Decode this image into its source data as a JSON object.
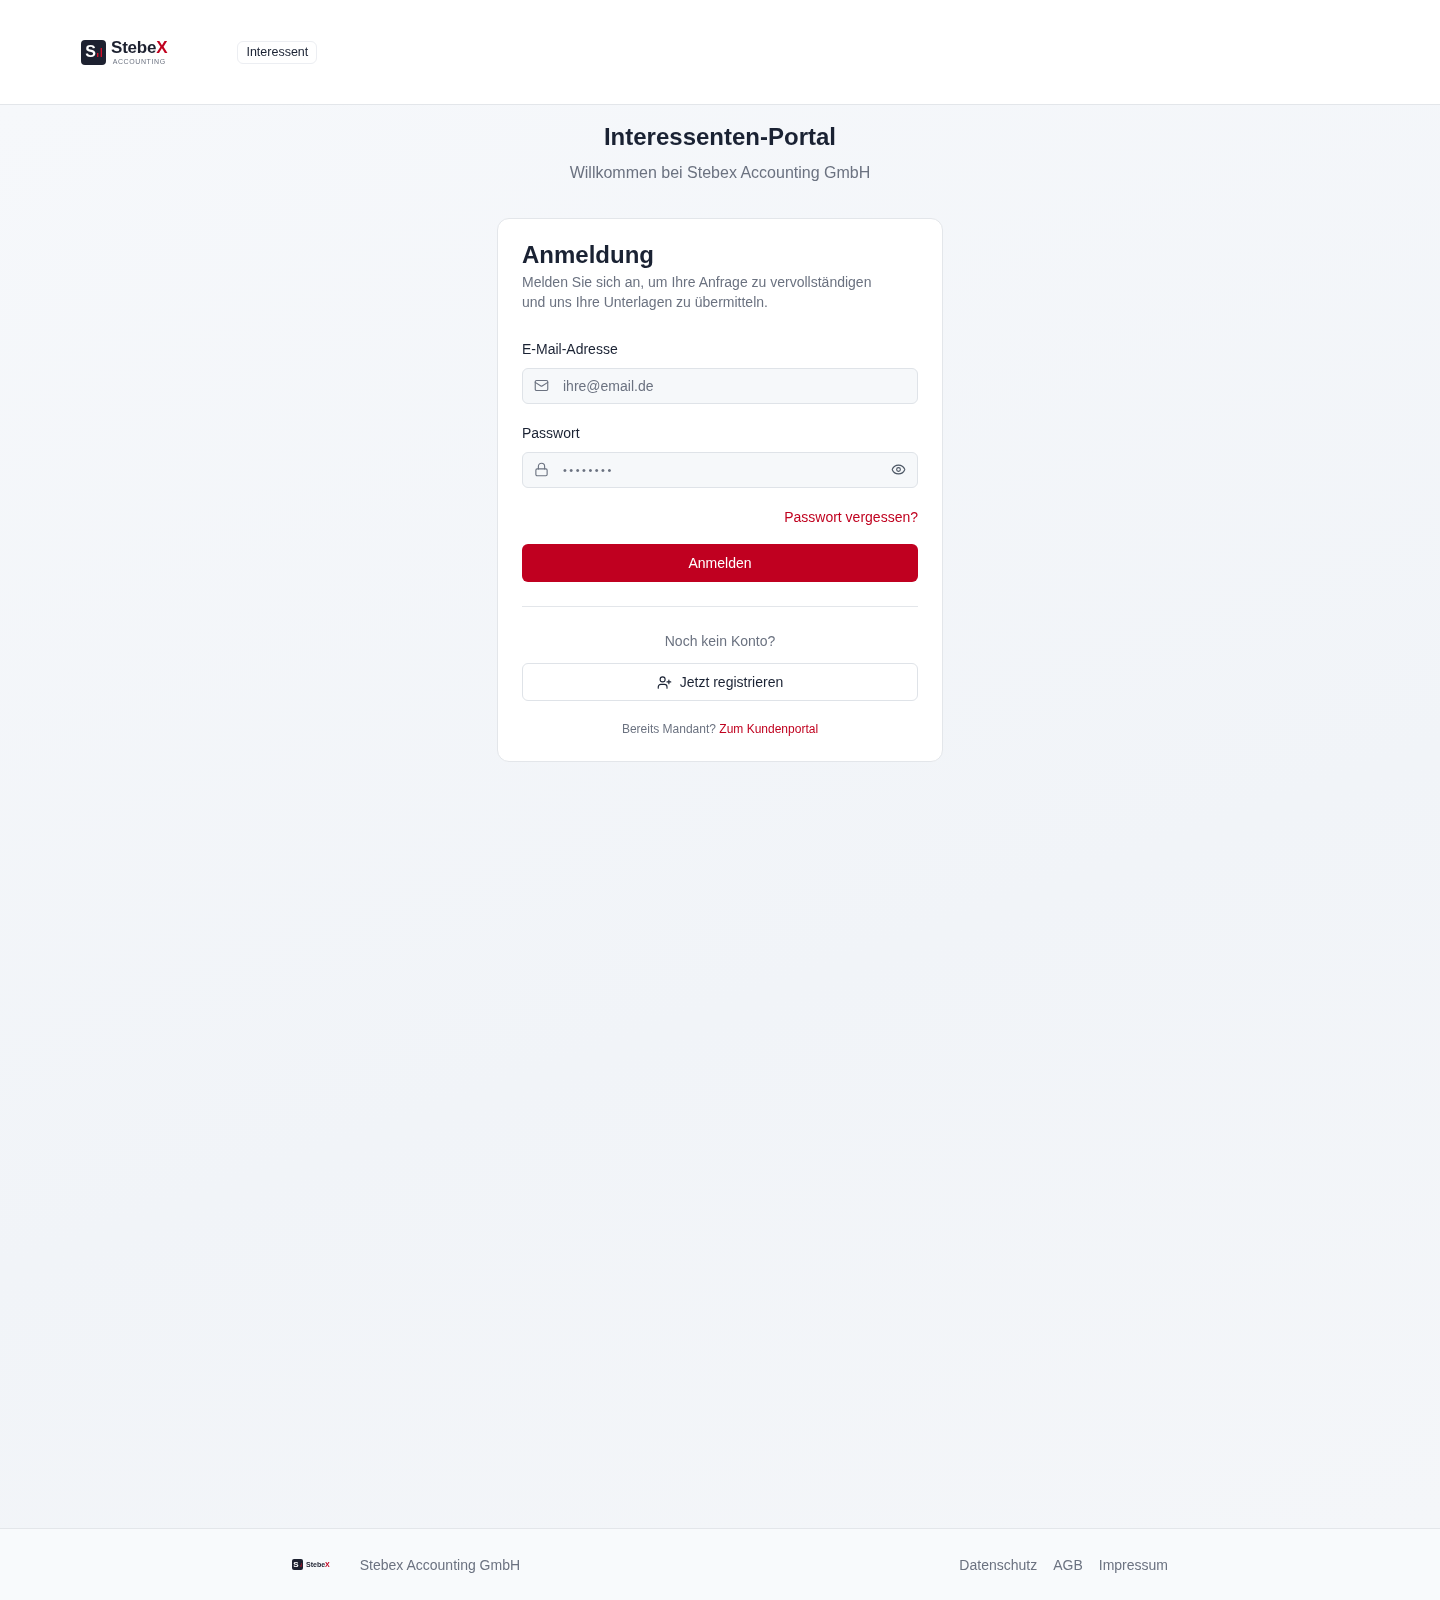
{
  "header": {
    "logo": {
      "letter": "S",
      "name": "Stebe",
      "name_accent": "X",
      "tagline": "ACCOUNTING"
    },
    "role_badge": "Interessent"
  },
  "intro": {
    "title": "Interessenten-Portal",
    "subtitle": "Willkommen bei Stebex Accounting GmbH"
  },
  "login_card": {
    "title": "Anmeldung",
    "description": "Melden Sie sich an, um Ihre Anfrage zu vervollständigen und uns Ihre Unterlagen zu übermitteln.",
    "fields": [
      {
        "kind": "email",
        "label": "E-Mail-Adresse",
        "placeholder": "ihre@email.de"
      },
      {
        "kind": "password",
        "label": "Passwort",
        "value": "••••••••"
      }
    ],
    "forgot_link": "Passwort vergessen?",
    "submit_button": "Anmelden",
    "register_prompt": "Noch kein Konto?",
    "register_button": "Jetzt registrieren",
    "client_prompt": "Bereits Mandant?",
    "client_link": "Zum Kundenportal"
  },
  "footer": {
    "logo": {
      "letter": "S",
      "name": "Stebe",
      "name_accent": "X"
    },
    "company": "Stebex Accounting GmbH",
    "links": [
      "Datenschutz",
      "AGB",
      "Impressum"
    ]
  }
}
